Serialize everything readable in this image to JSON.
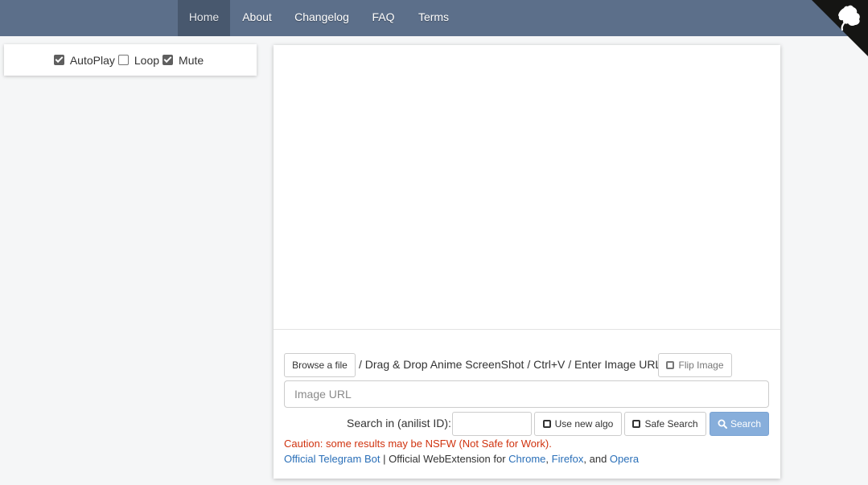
{
  "nav": {
    "items": [
      {
        "label": "Home",
        "active": true
      },
      {
        "label": "About",
        "active": false
      },
      {
        "label": "Changelog",
        "active": false
      },
      {
        "label": "FAQ",
        "active": false
      },
      {
        "label": "Terms",
        "active": false
      }
    ],
    "corner_icon": "github-octocat-icon"
  },
  "player": {
    "autoplay": {
      "label": "AutoPlay",
      "checked": true
    },
    "loop": {
      "label": "Loop",
      "checked": false
    },
    "mute": {
      "label": "Mute",
      "checked": true
    }
  },
  "upload": {
    "browse_label": "Browse a file",
    "instructions": "/ Drag & Drop Anime ScreenShot / Ctrl+V / Enter Image URL",
    "flip_label": "Flip Image",
    "url_placeholder": "Image URL",
    "url_value": ""
  },
  "search": {
    "anilist_label": "Search in (anilist ID):",
    "anilist_value": "",
    "new_algo_label": "Use new algo",
    "safe_search_label": "Safe Search",
    "search_label": "Search"
  },
  "caution": "Caution: some results may be NSFW (Not Safe for Work).",
  "footer": {
    "telegram": "Official Telegram Bot",
    "separator": " | ",
    "webext_prefix": "Official WebExtension for ",
    "chrome": "Chrome",
    "comma": ", ",
    "firefox": "Firefox",
    "and": ", and ",
    "opera": "Opera"
  },
  "colors": {
    "navbar": "#5c6f8a",
    "nav_active": "#48586e",
    "search_button": "#87aedb",
    "caution_text": "#d0330f",
    "link": "#2a6fb8"
  }
}
